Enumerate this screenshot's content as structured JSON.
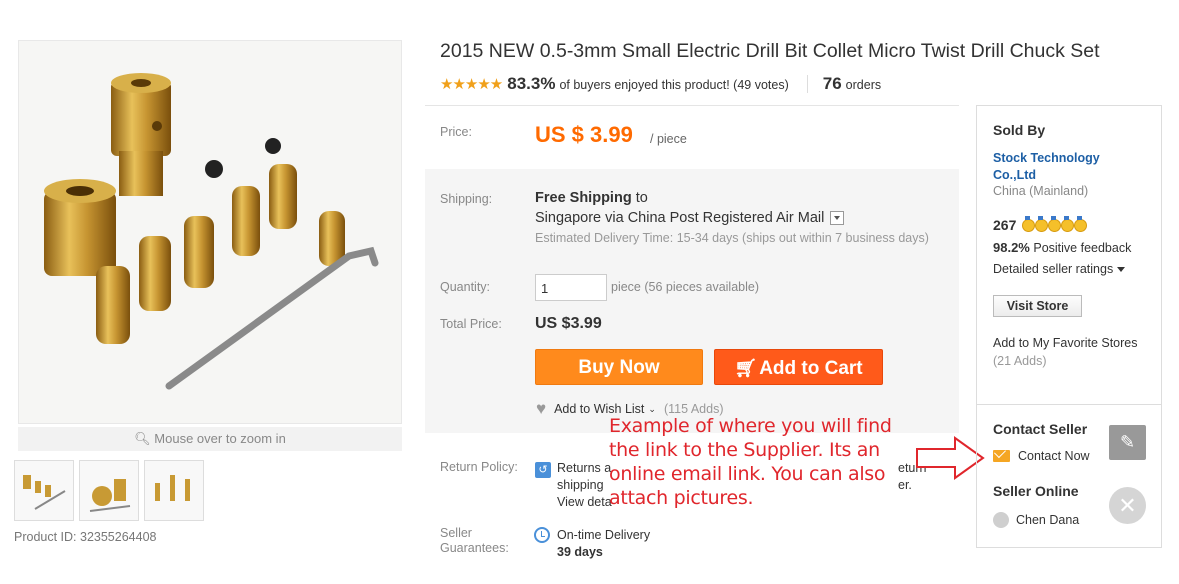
{
  "product": {
    "title": "2015 NEW 0.5-3mm Small Electric Drill Bit Collet Micro Twist Drill Chuck Set",
    "stars": "★★★★★",
    "rating_percent": "83.3%",
    "rating_text": "of buyers enjoyed this product! (49 votes)",
    "orders_count": "76",
    "orders_label": "orders",
    "zoom_hint": "Mouse over to zoom in",
    "product_id": "Product ID: 32355264408"
  },
  "price": {
    "label": "Price:",
    "value": "US $ 3.99",
    "unit": "/ piece"
  },
  "shipping": {
    "label": "Shipping:",
    "free": "Free Shipping",
    "to": "to",
    "destination": "Singapore via China Post Registered Air Mail",
    "estimate": "Estimated Delivery Time: 15-34 days (ships out within 7 business days)"
  },
  "quantity": {
    "label": "Quantity:",
    "value": "1",
    "note": "piece (56 pieces available)"
  },
  "total": {
    "label": "Total Price:",
    "value": "US $3.99"
  },
  "buttons": {
    "buy_now": "Buy Now",
    "add_to_cart": "Add to Cart"
  },
  "wishlist": {
    "label": "Add to Wish List",
    "adds": "(115 Adds)"
  },
  "return_policy": {
    "label": "Return Policy:",
    "line1": "Returns a",
    "line2": "shipping",
    "line3": "View deta",
    "right1": "eturn",
    "right2": "er."
  },
  "guarantee": {
    "label_line1": "Seller",
    "label_line2": "Guarantees:",
    "title": "On-time Delivery",
    "days": "39 days"
  },
  "annotation": {
    "text": "Example of where you will find the link to the Supplier. Its an online email link. You can also attach pictures.",
    "color": "#e0262c"
  },
  "seller": {
    "sold_by": "Sold By",
    "store_name": "Stock Technology Co.,Ltd",
    "country": "China (Mainland)",
    "score": "267",
    "feedback_pct": "98.2%",
    "feedback_text": "Positive feedback",
    "ratings_link": "Detailed seller ratings",
    "visit_store": "Visit Store",
    "favorite_text": "Add to My Favorite Stores",
    "favorite_adds": "(21 Adds)",
    "contact_title": "Contact Seller",
    "contact_now": "Contact Now",
    "online_title": "Seller Online",
    "online_name": "Chen Dana"
  },
  "colors": {
    "price_orange": "#ff6a00",
    "buy_now": "#ff8a1c",
    "add_to_cart": "#ff5a1a",
    "link_blue": "#1d5fa5"
  }
}
